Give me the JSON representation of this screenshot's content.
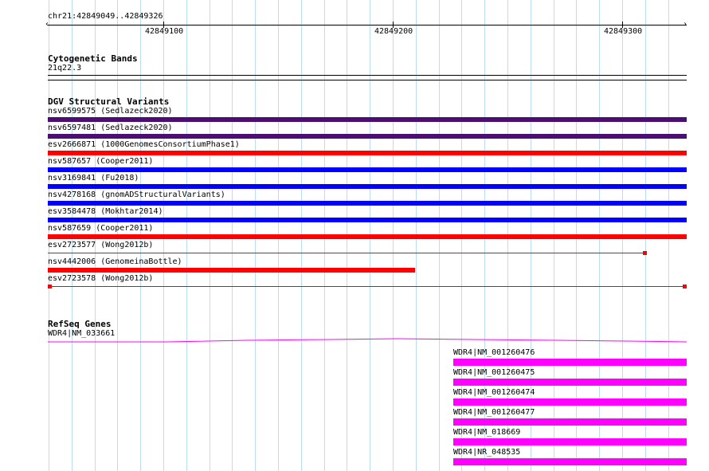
{
  "region": {
    "label": "chr21:42849049..42849326",
    "ticks": [
      "42849100",
      "42849200",
      "42849300"
    ]
  },
  "cytobands": {
    "title": "Cytogenetic Bands",
    "band": "21q22.3"
  },
  "dgv": {
    "title": "DGV Structural Variants",
    "items": [
      {
        "label": "nsv6599575 (Sedlazeck2020)",
        "color": "#4b0f72"
      },
      {
        "label": "nsv6597481 (Sedlazeck2020)",
        "color": "#4b0f72"
      },
      {
        "label": "esv2666871 (1000GenomesConsortiumPhase1)",
        "color": "#ff0000"
      },
      {
        "label": "nsv587657 (Cooper2011)",
        "color": "#0000ff"
      },
      {
        "label": "nsv3169841 (Fu2018)",
        "color": "#0000ff"
      },
      {
        "label": "nsv4278168 (gnomADStructuralVariants)",
        "color": "#0000ff"
      },
      {
        "label": "esv3584478 (Mokhtar2014)",
        "color": "#0000ff"
      },
      {
        "label": "nsv587659 (Cooper2011)",
        "color": "#ff0000"
      },
      {
        "label": "esv2723577 (Wong2012b)",
        "color": "#ff0000"
      },
      {
        "label": "nsv4442006 (GenomeinaBottle)",
        "color": "#ff0000"
      },
      {
        "label": "esv2723578 (Wong2012b)",
        "color": "#ff0000"
      }
    ]
  },
  "refseq": {
    "title": "RefSeq Genes",
    "main_gene": "WDR4|NM_033661",
    "gene_color": "#ff00ff",
    "isoforms": [
      "WDR4|NM_001260476",
      "WDR4|NM_001260475",
      "WDR4|NM_001260474",
      "WDR4|NM_001260477",
      "WDR4|NM_018669",
      "WDR4|NR_048535"
    ]
  }
}
